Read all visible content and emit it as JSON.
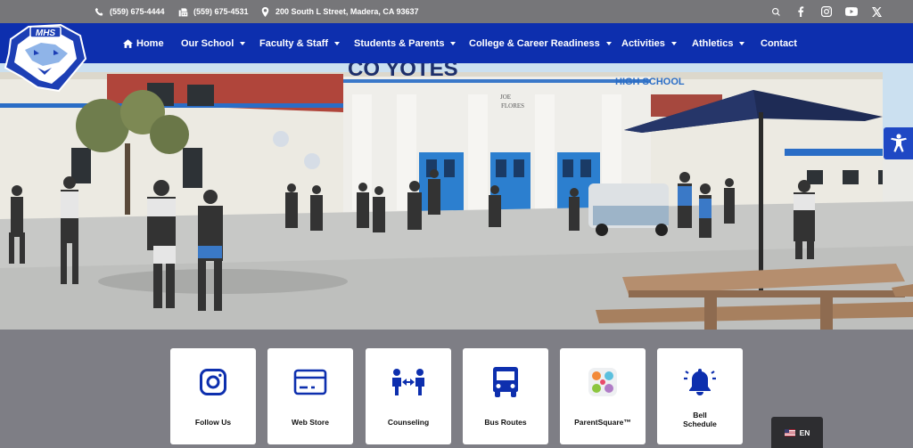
{
  "contact": {
    "phone1": "(559) 675-4444",
    "phone2": "(559) 675-4531",
    "address": "200 South L Street, Madera, CA 93637"
  },
  "social": [
    "search-icon",
    "facebook-icon",
    "instagram-icon",
    "youtube-icon",
    "x-icon"
  ],
  "logo_text": "MHS",
  "nav": {
    "home": "Home",
    "items": [
      "Our School",
      "Faculty & Staff",
      "Students & Parents",
      "College & Career Readiness",
      "Activities",
      "Athletics"
    ],
    "contact": "Contact"
  },
  "hero": {
    "sign": "HIGH SCHOOL",
    "plaque": [
      "JOE",
      "FLORES"
    ]
  },
  "cards": [
    {
      "label": "Follow Us",
      "icon": "instagram-icon"
    },
    {
      "label": "Web Store",
      "icon": "credit-card-icon"
    },
    {
      "label": "Counseling",
      "icon": "people-arrows-icon"
    },
    {
      "label": "Bus Routes",
      "icon": "bus-icon"
    },
    {
      "label": "ParentSquare™",
      "icon": "parentsquare-icon"
    },
    {
      "label": "Bell Schedule",
      "icon": "bell-icon",
      "lines": [
        "Bell",
        "Schedule"
      ]
    }
  ],
  "language": {
    "code": "EN",
    "icon": "us-flag-icon"
  },
  "colors": {
    "nav": "#0d2fae",
    "topbar": "#767679",
    "accent": "#1f48c4",
    "background": "#7e7e85"
  }
}
